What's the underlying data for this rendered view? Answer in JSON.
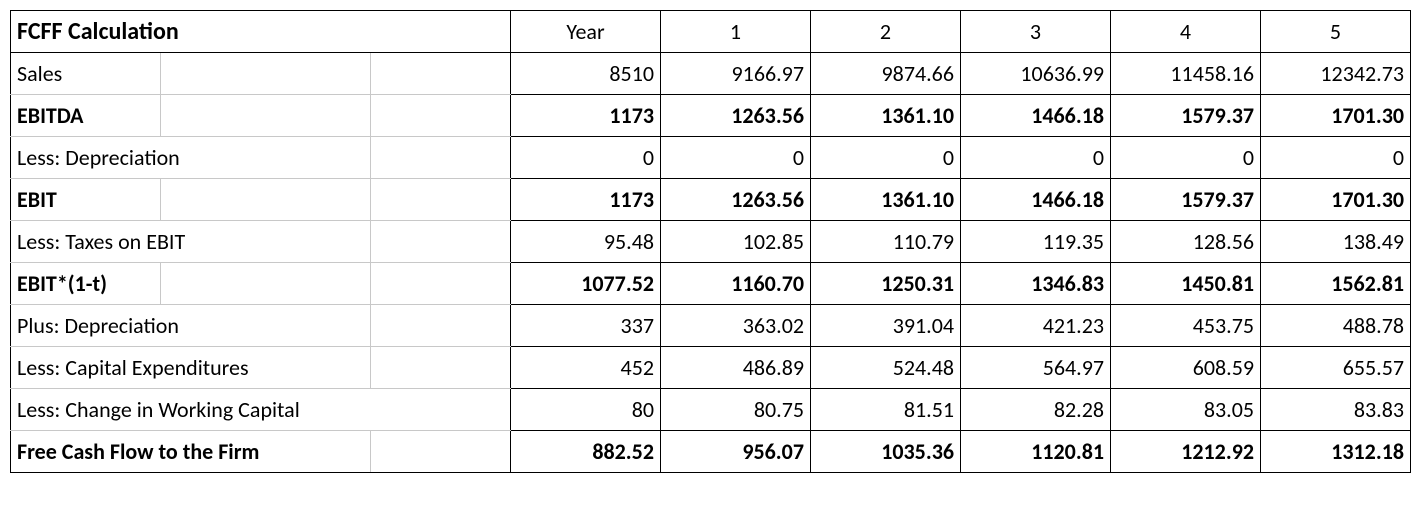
{
  "chart_data": {
    "type": "table",
    "title": "FCFF Calculation",
    "columns": [
      "Year",
      "1",
      "2",
      "3",
      "4",
      "5"
    ],
    "rows": [
      {
        "label": "Sales",
        "bold": false,
        "values": [
          "8510",
          "9166.97",
          "9874.66",
          "10636.99",
          "11458.16",
          "12342.73"
        ]
      },
      {
        "label": "EBITDA",
        "bold": true,
        "values": [
          "1173",
          "1263.56",
          "1361.10",
          "1466.18",
          "1579.37",
          "1701.30"
        ]
      },
      {
        "label": "Less: Depreciation",
        "bold": false,
        "values": [
          "0",
          "0",
          "0",
          "0",
          "0",
          "0"
        ]
      },
      {
        "label": "EBIT",
        "bold": true,
        "values": [
          "1173",
          "1263.56",
          "1361.10",
          "1466.18",
          "1579.37",
          "1701.30"
        ]
      },
      {
        "label": "Less: Taxes on EBIT",
        "bold": false,
        "values": [
          "95.48",
          "102.85",
          "110.79",
          "119.35",
          "128.56",
          "138.49"
        ]
      },
      {
        "label": "EBIT*(1-t)",
        "bold": true,
        "values": [
          "1077.52",
          "1160.70",
          "1250.31",
          "1346.83",
          "1450.81",
          "1562.81"
        ]
      },
      {
        "label": "Plus: Depreciation",
        "bold": false,
        "values": [
          "337",
          "363.02",
          "391.04",
          "421.23",
          "453.75",
          "488.78"
        ]
      },
      {
        "label": "Less: Capital Expenditures",
        "bold": false,
        "values": [
          "452",
          "486.89",
          "524.48",
          "564.97",
          "608.59",
          "655.57"
        ]
      },
      {
        "label": "Less: Change in Working Capital",
        "bold": false,
        "values": [
          "80",
          "80.75",
          "81.51",
          "82.28",
          "83.05",
          "83.83"
        ]
      },
      {
        "label": "Free Cash Flow to the Firm",
        "bold": true,
        "values": [
          "882.52",
          "956.07",
          "1035.36",
          "1120.81",
          "1212.92",
          "1312.18"
        ]
      }
    ]
  }
}
